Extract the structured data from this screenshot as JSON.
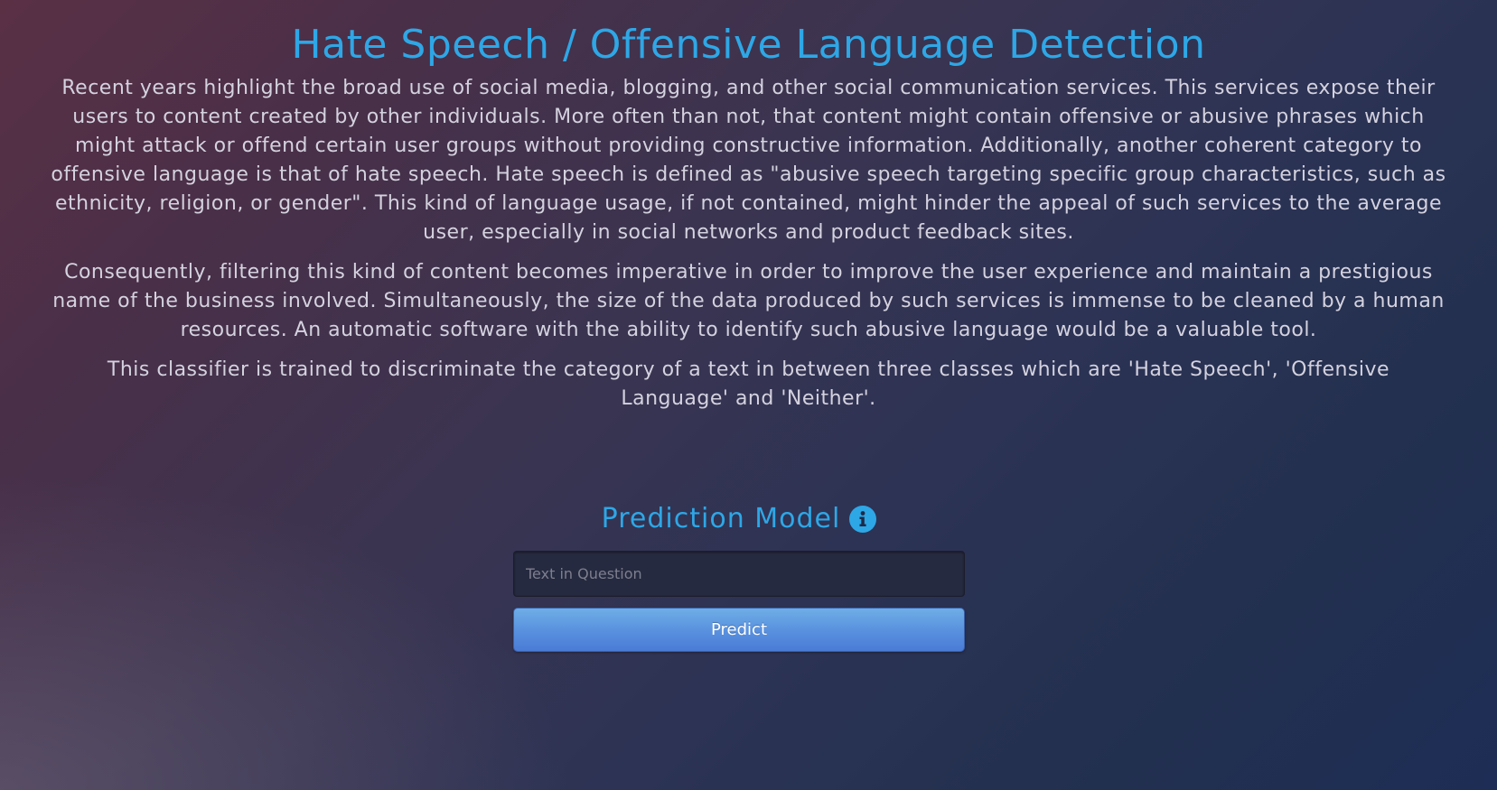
{
  "page": {
    "title": "Hate Speech / Offensive Language Detection",
    "paragraphs": [
      "Recent years highlight the broad use of social media, blogging, and other social communication services. This services expose their users to content created by other individuals. More often than not, that content might contain offensive or abusive phrases which might attack or offend certain user groups without providing constructive information. Additionally, another coherent category to offensive language is that of hate speech. Hate speech is defined as \"abusive speech targeting specific group characteristics, such as ethnicity, religion, or gender\". This kind of language usage, if not contained, might hinder the appeal of such services to the average user, especially in social networks and product feedback sites.",
      "Consequently, filtering this kind of content becomes imperative in order to improve the user experience and maintain a prestigious name of the business involved. Simultaneously, the size of the data produced by such services is immense to be cleaned by a human resources. An automatic software with the ability to identify such abusive language would be a valuable tool.",
      "This classifier is trained to discriminate the category of a text in between three classes which are 'Hate Speech', 'Offensive Language' and 'Neither'."
    ]
  },
  "model": {
    "title": "Prediction Model",
    "info_icon": "info-circle-icon",
    "input_value": "",
    "input_placeholder": "Text in Question",
    "predict_label": "Predict"
  },
  "colors": {
    "accent": "#2ea7e6",
    "button": "#5a92df",
    "text": "#d4d2df"
  }
}
